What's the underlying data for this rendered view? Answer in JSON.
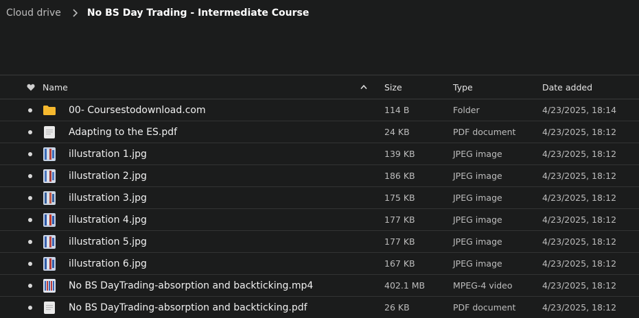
{
  "breadcrumb": {
    "root": "Cloud drive",
    "current": "No BS Day Trading - Intermediate Course"
  },
  "columns": {
    "name": "Name",
    "size": "Size",
    "type": "Type",
    "date": "Date added"
  },
  "files": [
    {
      "name": "00- Coursestodownload.com",
      "size": "114 B",
      "type": "Folder",
      "date": "4/23/2025, 18:14",
      "icon": "folder-icon"
    },
    {
      "name": "Adapting to the ES.pdf",
      "size": "24 KB",
      "type": "PDF document",
      "date": "4/23/2025, 18:12",
      "icon": "pdf-file-icon"
    },
    {
      "name": "illustration 1.jpg",
      "size": "139 KB",
      "type": "JPEG image",
      "date": "4/23/2025, 18:12",
      "icon": "image-thumbnail-icon"
    },
    {
      "name": "illustration 2.jpg",
      "size": "186 KB",
      "type": "JPEG image",
      "date": "4/23/2025, 18:12",
      "icon": "image-thumbnail-icon"
    },
    {
      "name": "illustration 3.jpg",
      "size": "175 KB",
      "type": "JPEG image",
      "date": "4/23/2025, 18:12",
      "icon": "image-thumbnail-icon"
    },
    {
      "name": "illustration 4.jpg",
      "size": "177 KB",
      "type": "JPEG image",
      "date": "4/23/2025, 18:12",
      "icon": "image-thumbnail-icon"
    },
    {
      "name": "illustration 5.jpg",
      "size": "177 KB",
      "type": "JPEG image",
      "date": "4/23/2025, 18:12",
      "icon": "image-thumbnail-icon"
    },
    {
      "name": "illustration 6.jpg",
      "size": "167 KB",
      "type": "JPEG image",
      "date": "4/23/2025, 18:12",
      "icon": "image-thumbnail-icon"
    },
    {
      "name": "No BS DayTrading-absorption and backticking.mp4",
      "size": "402.1 MB",
      "type": "MPEG-4 video",
      "date": "4/23/2025, 18:12",
      "icon": "video-thumbnail-icon"
    },
    {
      "name": "No BS DayTrading-absorption and backticking.pdf",
      "size": "26 KB",
      "type": "PDF document",
      "date": "4/23/2025, 18:12",
      "icon": "pdf-file-icon"
    }
  ],
  "colors": {
    "background": "#1b1c1c",
    "folder": "#f5b82e",
    "divider": "#333434"
  }
}
